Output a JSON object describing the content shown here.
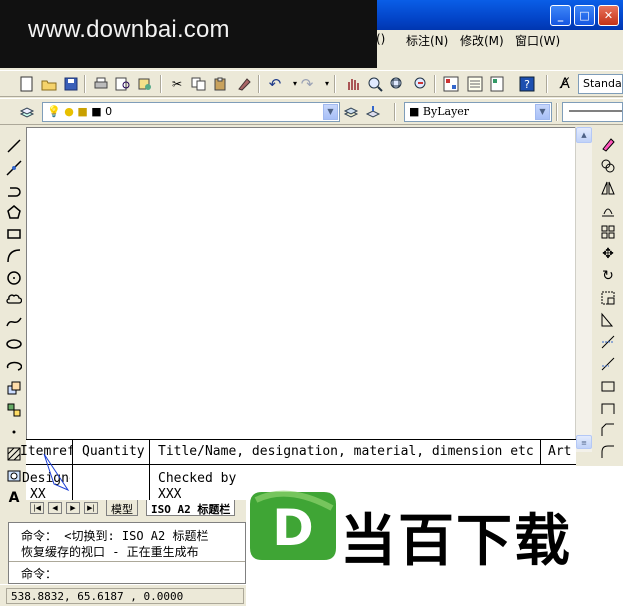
{
  "watermark": {
    "text": "www.downbai.com"
  },
  "window": {
    "minimize_glyph": "_",
    "maximize_glyph": "□",
    "close_glyph": "✕"
  },
  "menu": {
    "items": [
      "()",
      "标注(N)",
      "修改(M)",
      "窗口(W)"
    ]
  },
  "mdi": {
    "minimize": "_",
    "restore": "❐",
    "close": "✕"
  },
  "toolbar_standard": {
    "icons": [
      "new-icon",
      "open-icon",
      "save-icon",
      "print-icon",
      "plot-preview-icon",
      "publish-icon",
      "cut-icon",
      "copy-icon",
      "paste-icon",
      "match-properties-icon",
      "undo-icon",
      "redo-icon",
      "pan-icon",
      "zoom-realtime-icon",
      "zoom-window-icon",
      "zoom-previous-icon",
      "properties-icon",
      "design-center-icon",
      "tool-palettes-icon",
      "help-icon",
      "text-style-icon"
    ],
    "text_style_value": "Standa"
  },
  "toolbar_layers": {
    "layer_value": "0",
    "color_value": "ByLayer"
  },
  "drawing": {
    "table": {
      "row1": [
        "Itemref",
        "Quantity",
        "Title/Name, designation, material, dimension etc",
        "Art"
      ],
      "row2": [
        "Designed by",
        "Checked by"
      ],
      "row3": [
        "XX",
        "XXX"
      ]
    }
  },
  "tabs": {
    "model": "模型",
    "layout": "ISO A2 标题栏"
  },
  "command": {
    "line1": "命令：  <切换到: ISO A2 标题栏",
    "line2": "恢复缓存的视口 - 正在重生成布",
    "prompt": "命令："
  },
  "status": {
    "coordinates": "538.8832, 65.6187 , 0.0000"
  },
  "brand": {
    "logo_letter": "D",
    "name": "当百下载",
    "logo_color": "#3fa535"
  }
}
